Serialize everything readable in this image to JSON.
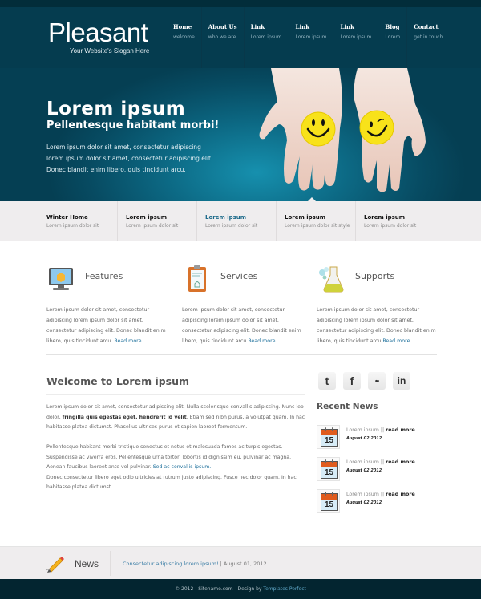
{
  "header": {
    "logo": "Pleasant",
    "slogan": "Your Website's Slogan Here",
    "nav": [
      {
        "title": "Home",
        "sub": "welcome"
      },
      {
        "title": "About Us",
        "sub": "who we are"
      },
      {
        "title": "Link",
        "sub": "Lorem ipsum"
      },
      {
        "title": "Link",
        "sub": "Lorem ipsum"
      },
      {
        "title": "Link",
        "sub": "Lorem ipsum"
      },
      {
        "title": "Blog",
        "sub": "Lorem"
      },
      {
        "title": "Contact",
        "sub": "get in touch"
      }
    ]
  },
  "hero": {
    "title": "Lorem ipsum",
    "subtitle": "Pellentesque habitant morbi!",
    "text": "Lorem ipsum dolor sit amet, consectetur adipiscing lorem ipsum dolor sit amet, consectetur adipiscing elit. Donec blandit enim libero, quis tincidunt arcu.",
    "image": "hands-holding-smiley-badges"
  },
  "subnav": [
    {
      "title": "Winter Home",
      "sub": "Lorem ipsum dolor sit",
      "active": false
    },
    {
      "title": "Lorem ipsum",
      "sub": "Lorem ipsum dolor sit",
      "active": false
    },
    {
      "title": "Lorem ipsum",
      "sub": "Lorem ipsum dolor sit",
      "active": true
    },
    {
      "title": "Lorem ipsum",
      "sub": "Lorem ipsum dolor sit style",
      "active": false
    },
    {
      "title": "Lorem ipsum",
      "sub": "Lorem ipsum dolor sit",
      "active": false
    }
  ],
  "features": [
    {
      "icon": "monitor-icon",
      "title": "Features",
      "text": "Lorem ipsum dolor sit amet, consectetur adipiscing lorem ipsum dolor sit amet, consectetur adipiscing elit. Donec blandit enim libero, quis tincidunt arcu.",
      "link": "Read more..."
    },
    {
      "icon": "clipboard-icon",
      "title": "Services",
      "text": "Lorem ipsum dolor sit amet, consectetur adipiscing lorem ipsum dolor sit amet, consectetur adipiscing elit. Donec blandit enim libero, quis tincidunt arcu.",
      "link": "Read more..."
    },
    {
      "icon": "flask-icon",
      "title": "Supports",
      "text": "Lorem ipsum dolor sit amet, consectetur adipiscing lorem ipsum dolor sit amet, consectetur adipiscing elit. Donec blandit enim libero, quis tincidunt arcu.",
      "link": "Read more..."
    }
  ],
  "welcome": {
    "title": "Welcome to Lorem ipsum",
    "p1_start": "Lorem ipsum dolor sit amet, consectetur adipiscing elit. Nulla scelerisque convallis adipiscing. Nunc leo dolor, ",
    "p1_bold": "fringilla quis egestas eget, hendrerit id velit",
    "p1_end": ". Etiam sed nibh purus, a volutpat quam. In hac habitasse platea dictumst. Phasellus ultrices purus et sapien laoreet fermentum.",
    "p2_start": "Pellentesque habitant morbi tristique senectus et netus et malesuada fames ac turpis egestas. Suspendisse ac viverra eros. Pellentesque urna tortor, lobortis id dignissim eu, pulvinar ac magna. Aenean faucibus laoreet ante vel pulvinar. ",
    "p2_link": "Sed ac convallis ipsum.",
    "p3": "Donec consectetur libero eget odio ultricies at rutrum justo adipiscing. Fusce nec dolor quam. In hac habitasse platea dictumst."
  },
  "sidebar": {
    "social": [
      {
        "name": "twitter",
        "glyph": "t"
      },
      {
        "name": "facebook",
        "glyph": "f"
      },
      {
        "name": "flickr",
        "glyph": "••"
      },
      {
        "name": "linkedin",
        "glyph": "in"
      }
    ],
    "recent_title": "Recent News",
    "news": [
      {
        "day": "15",
        "text": "Lorem ipsum",
        "sep": " || ",
        "more": "read more",
        "date": "August 02 2012"
      },
      {
        "day": "15",
        "text": "Lorem ipsum",
        "sep": " || ",
        "more": "read more",
        "date": "August 02 2012"
      },
      {
        "day": "15",
        "text": "Lorem ipsum",
        "sep": " || ",
        "more": "read more",
        "date": "August 02 2012"
      }
    ]
  },
  "newsbar": {
    "label": "News",
    "headline": "Consectetur adipiscing lorem ipsum!",
    "sep": " | ",
    "date": "August 01, 2012"
  },
  "footer": {
    "text": "© 2012 - Sitename.com - Design by ",
    "link": "Templates Perfect"
  },
  "colors": {
    "header_bg": "#053c4f",
    "accent_link": "#1b6e9a",
    "subnav_bg": "#efedee",
    "footer_bg": "#032530"
  }
}
